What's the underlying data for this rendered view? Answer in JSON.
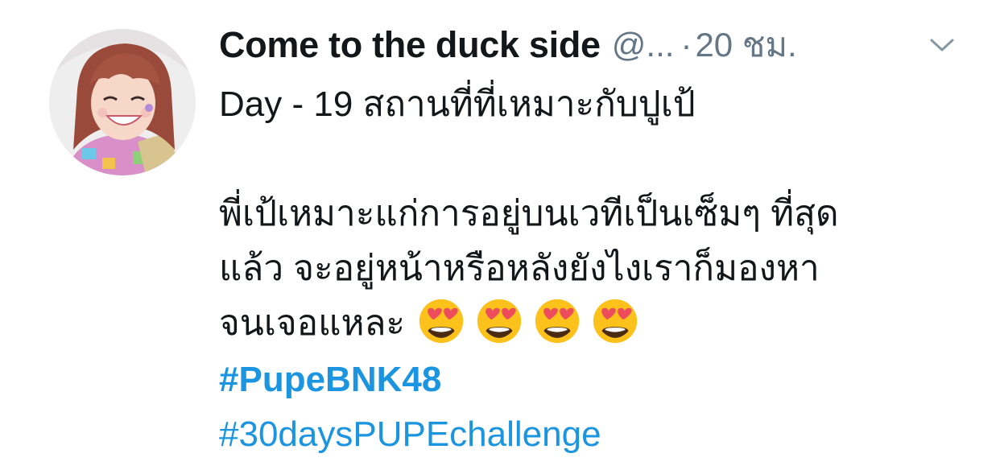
{
  "tweet": {
    "display_name": "Come to the duck side",
    "handle": "@...",
    "separator": "·",
    "time": "20 ชม.",
    "lines": [
      "Day - 19 สถานที่ที่เหมาะกับปูเป้",
      "",
      "พี่เป้เหมาะแก่การอยู่บนเวทีเป็นเซ็มๆ ที่สุด",
      "แล้ว จะอยู่หน้าหรือหลังยังไงเราก็มองหา",
      "จนเจอแหละ"
    ],
    "emojis": [
      "heart-eyes-emoji",
      "heart-eyes-emoji",
      "heart-eyes-emoji",
      "heart-eyes-emoji"
    ],
    "hashtags": [
      "#PupeBNK48",
      "#30daysPUPEchallenge"
    ]
  },
  "colors": {
    "text": "#14171a",
    "secondary": "#657786",
    "link": "#1b95e0"
  }
}
